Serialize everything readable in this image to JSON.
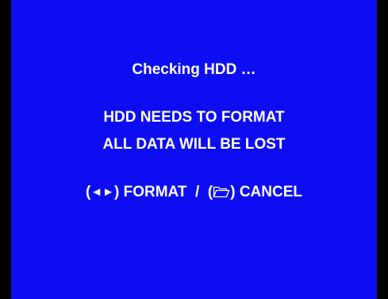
{
  "colors": {
    "screen_bg": "#0d0df2",
    "frame": "#000000",
    "text": "#ffffff"
  },
  "dialog": {
    "status": "Checking HDD …",
    "warning_line1": "HDD NEEDS TO FORMAT",
    "warning_line2": "ALL DATA WILL BE LOST",
    "format_arrows": "◄►",
    "format_label": "FORMAT",
    "separator": "/",
    "cancel_label": "CANCEL",
    "open_paren": "(",
    "close_paren": ")"
  },
  "icons": {
    "format": "left-right-arrows-icon",
    "cancel": "folder-icon"
  }
}
